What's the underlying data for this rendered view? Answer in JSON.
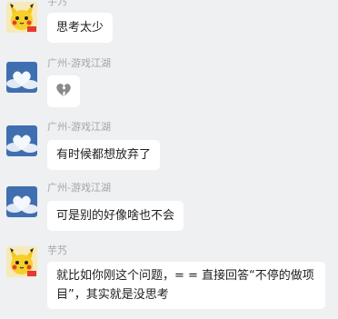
{
  "messages": [
    {
      "sender": "芋艿",
      "avatar": "pikachu-avatar",
      "text": "思考太少"
    },
    {
      "sender": "广州-游戏江湖",
      "avatar": "cloud-heart-avatar",
      "emoji": "broken-heart-icon"
    },
    {
      "sender": "广州-游戏江湖",
      "avatar": "cloud-heart-avatar",
      "text": "有时候都想放弃了"
    },
    {
      "sender": "广州-游戏江湖",
      "avatar": "cloud-heart-avatar",
      "text": "可是别的好像啥也不会"
    },
    {
      "sender": "芋艿",
      "avatar": "pikachu-avatar",
      "text": "就比如你刚这个问题，= = 直接回答“不停的做项目”，其实就是没思考"
    }
  ],
  "colors": {
    "background": "#eef0f2",
    "bubble": "#ffffff",
    "sender_name": "#a3a6aa",
    "text": "#1f1f1f"
  }
}
